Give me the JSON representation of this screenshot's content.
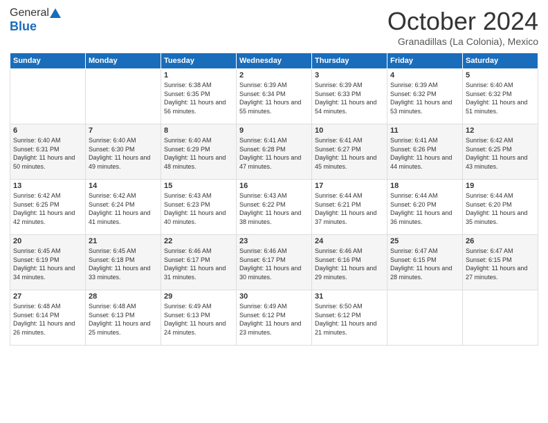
{
  "logo": {
    "general": "General",
    "blue": "Blue"
  },
  "header": {
    "month": "October 2024",
    "location": "Granadillas (La Colonia), Mexico"
  },
  "weekdays": [
    "Sunday",
    "Monday",
    "Tuesday",
    "Wednesday",
    "Thursday",
    "Friday",
    "Saturday"
  ],
  "weeks": [
    [
      {
        "day": "",
        "info": ""
      },
      {
        "day": "",
        "info": ""
      },
      {
        "day": "1",
        "info": "Sunrise: 6:38 AM\nSunset: 6:35 PM\nDaylight: 11 hours and 56 minutes."
      },
      {
        "day": "2",
        "info": "Sunrise: 6:39 AM\nSunset: 6:34 PM\nDaylight: 11 hours and 55 minutes."
      },
      {
        "day": "3",
        "info": "Sunrise: 6:39 AM\nSunset: 6:33 PM\nDaylight: 11 hours and 54 minutes."
      },
      {
        "day": "4",
        "info": "Sunrise: 6:39 AM\nSunset: 6:32 PM\nDaylight: 11 hours and 53 minutes."
      },
      {
        "day": "5",
        "info": "Sunrise: 6:40 AM\nSunset: 6:32 PM\nDaylight: 11 hours and 51 minutes."
      }
    ],
    [
      {
        "day": "6",
        "info": "Sunrise: 6:40 AM\nSunset: 6:31 PM\nDaylight: 11 hours and 50 minutes."
      },
      {
        "day": "7",
        "info": "Sunrise: 6:40 AM\nSunset: 6:30 PM\nDaylight: 11 hours and 49 minutes."
      },
      {
        "day": "8",
        "info": "Sunrise: 6:40 AM\nSunset: 6:29 PM\nDaylight: 11 hours and 48 minutes."
      },
      {
        "day": "9",
        "info": "Sunrise: 6:41 AM\nSunset: 6:28 PM\nDaylight: 11 hours and 47 minutes."
      },
      {
        "day": "10",
        "info": "Sunrise: 6:41 AM\nSunset: 6:27 PM\nDaylight: 11 hours and 45 minutes."
      },
      {
        "day": "11",
        "info": "Sunrise: 6:41 AM\nSunset: 6:26 PM\nDaylight: 11 hours and 44 minutes."
      },
      {
        "day": "12",
        "info": "Sunrise: 6:42 AM\nSunset: 6:25 PM\nDaylight: 11 hours and 43 minutes."
      }
    ],
    [
      {
        "day": "13",
        "info": "Sunrise: 6:42 AM\nSunset: 6:25 PM\nDaylight: 11 hours and 42 minutes."
      },
      {
        "day": "14",
        "info": "Sunrise: 6:42 AM\nSunset: 6:24 PM\nDaylight: 11 hours and 41 minutes."
      },
      {
        "day": "15",
        "info": "Sunrise: 6:43 AM\nSunset: 6:23 PM\nDaylight: 11 hours and 40 minutes."
      },
      {
        "day": "16",
        "info": "Sunrise: 6:43 AM\nSunset: 6:22 PM\nDaylight: 11 hours and 38 minutes."
      },
      {
        "day": "17",
        "info": "Sunrise: 6:44 AM\nSunset: 6:21 PM\nDaylight: 11 hours and 37 minutes."
      },
      {
        "day": "18",
        "info": "Sunrise: 6:44 AM\nSunset: 6:20 PM\nDaylight: 11 hours and 36 minutes."
      },
      {
        "day": "19",
        "info": "Sunrise: 6:44 AM\nSunset: 6:20 PM\nDaylight: 11 hours and 35 minutes."
      }
    ],
    [
      {
        "day": "20",
        "info": "Sunrise: 6:45 AM\nSunset: 6:19 PM\nDaylight: 11 hours and 34 minutes."
      },
      {
        "day": "21",
        "info": "Sunrise: 6:45 AM\nSunset: 6:18 PM\nDaylight: 11 hours and 33 minutes."
      },
      {
        "day": "22",
        "info": "Sunrise: 6:46 AM\nSunset: 6:17 PM\nDaylight: 11 hours and 31 minutes."
      },
      {
        "day": "23",
        "info": "Sunrise: 6:46 AM\nSunset: 6:17 PM\nDaylight: 11 hours and 30 minutes."
      },
      {
        "day": "24",
        "info": "Sunrise: 6:46 AM\nSunset: 6:16 PM\nDaylight: 11 hours and 29 minutes."
      },
      {
        "day": "25",
        "info": "Sunrise: 6:47 AM\nSunset: 6:15 PM\nDaylight: 11 hours and 28 minutes."
      },
      {
        "day": "26",
        "info": "Sunrise: 6:47 AM\nSunset: 6:15 PM\nDaylight: 11 hours and 27 minutes."
      }
    ],
    [
      {
        "day": "27",
        "info": "Sunrise: 6:48 AM\nSunset: 6:14 PM\nDaylight: 11 hours and 26 minutes."
      },
      {
        "day": "28",
        "info": "Sunrise: 6:48 AM\nSunset: 6:13 PM\nDaylight: 11 hours and 25 minutes."
      },
      {
        "day": "29",
        "info": "Sunrise: 6:49 AM\nSunset: 6:13 PM\nDaylight: 11 hours and 24 minutes."
      },
      {
        "day": "30",
        "info": "Sunrise: 6:49 AM\nSunset: 6:12 PM\nDaylight: 11 hours and 23 minutes."
      },
      {
        "day": "31",
        "info": "Sunrise: 6:50 AM\nSunset: 6:12 PM\nDaylight: 11 hours and 21 minutes."
      },
      {
        "day": "",
        "info": ""
      },
      {
        "day": "",
        "info": ""
      }
    ]
  ]
}
